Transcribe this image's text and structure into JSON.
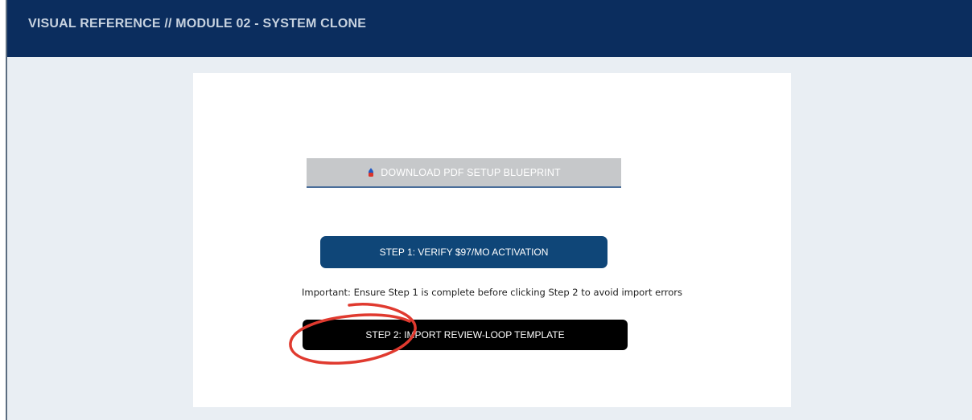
{
  "header": {
    "title": "VISUAL REFERENCE // MODULE 02 - SYSTEM CLONE"
  },
  "main": {
    "download_button": {
      "icon": "download-icon",
      "label": "DOWNLOAD PDF SETUP BLUEPRINT"
    },
    "step1_button": {
      "label": "STEP 1: VERIFY $97/MO ACTIVATION"
    },
    "important_note": "Important: Ensure Step 1 is complete before clicking Step 2 to avoid import errors",
    "step2_button": {
      "label": "STEP 2: IMPORT REVIEW-LOOP TEMPLATE"
    },
    "annotation": {
      "icon": "hand-drawn-circle-annotation"
    }
  },
  "colors": {
    "header_bg": "#0b2d5e",
    "header_text": "#c8d3e0",
    "page_bg": "#e9eef3",
    "panel_bg": "#ffffff",
    "download_button_bg": "#c6c8ca",
    "step1_button_bg": "#0f4678",
    "step2_button_bg": "#000000",
    "annotation_stroke": "#e03a2f"
  }
}
